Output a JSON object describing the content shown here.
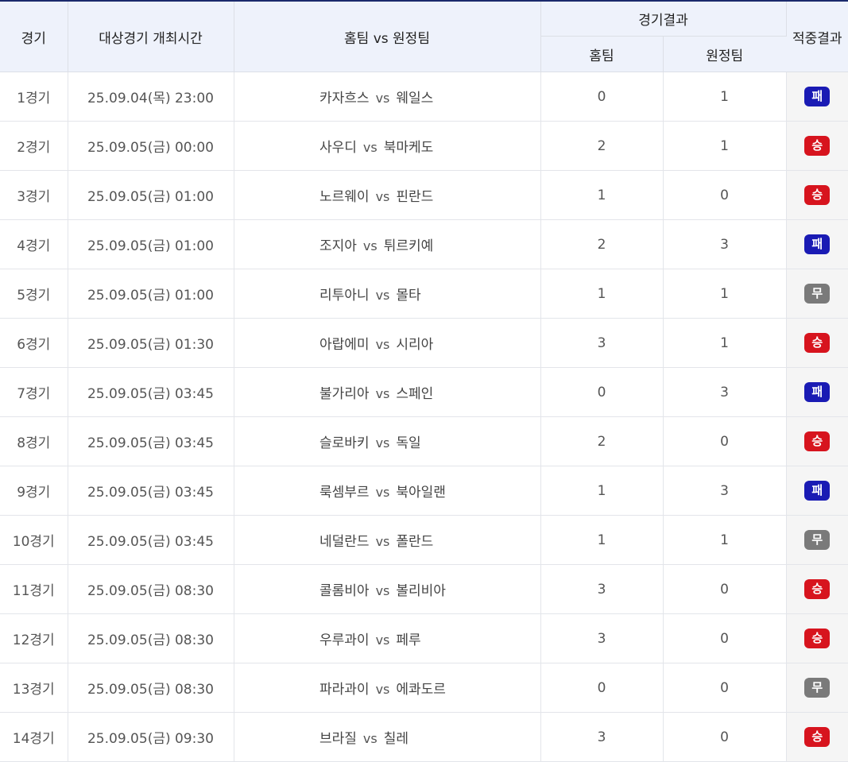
{
  "header": {
    "game": "경기",
    "time": "대상경기 개최시간",
    "match": "홈팀 vs 원정팀",
    "result_group": "경기결과",
    "home": "홈팀",
    "away": "원정팀",
    "hit": "적중결과"
  },
  "vs_label": "vs",
  "colors": {
    "win": "#d7141e",
    "lose": "#1a1bb4",
    "draw": "#7a7a7a",
    "header_bg": "#eef2fb"
  },
  "rows": [
    {
      "game": "1경기",
      "time": "25.09.04(목) 23:00",
      "home": "카자흐스",
      "away": "웨일스",
      "home_score": "0",
      "away_score": "1",
      "result": "패",
      "result_type": "lose"
    },
    {
      "game": "2경기",
      "time": "25.09.05(금) 00:00",
      "home": "사우디",
      "away": "북마케도",
      "home_score": "2",
      "away_score": "1",
      "result": "승",
      "result_type": "win"
    },
    {
      "game": "3경기",
      "time": "25.09.05(금) 01:00",
      "home": "노르웨이",
      "away": "핀란드",
      "home_score": "1",
      "away_score": "0",
      "result": "승",
      "result_type": "win"
    },
    {
      "game": "4경기",
      "time": "25.09.05(금) 01:00",
      "home": "조지아",
      "away": "튀르키예",
      "home_score": "2",
      "away_score": "3",
      "result": "패",
      "result_type": "lose"
    },
    {
      "game": "5경기",
      "time": "25.09.05(금) 01:00",
      "home": "리투아니",
      "away": "몰타",
      "home_score": "1",
      "away_score": "1",
      "result": "무",
      "result_type": "draw"
    },
    {
      "game": "6경기",
      "time": "25.09.05(금) 01:30",
      "home": "아랍에미",
      "away": "시리아",
      "home_score": "3",
      "away_score": "1",
      "result": "승",
      "result_type": "win"
    },
    {
      "game": "7경기",
      "time": "25.09.05(금) 03:45",
      "home": "불가리아",
      "away": "스페인",
      "home_score": "0",
      "away_score": "3",
      "result": "패",
      "result_type": "lose"
    },
    {
      "game": "8경기",
      "time": "25.09.05(금) 03:45",
      "home": "슬로바키",
      "away": "독일",
      "home_score": "2",
      "away_score": "0",
      "result": "승",
      "result_type": "win"
    },
    {
      "game": "9경기",
      "time": "25.09.05(금) 03:45",
      "home": "룩셈부르",
      "away": "북아일랜",
      "home_score": "1",
      "away_score": "3",
      "result": "패",
      "result_type": "lose"
    },
    {
      "game": "10경기",
      "time": "25.09.05(금) 03:45",
      "home": "네덜란드",
      "away": "폴란드",
      "home_score": "1",
      "away_score": "1",
      "result": "무",
      "result_type": "draw"
    },
    {
      "game": "11경기",
      "time": "25.09.05(금) 08:30",
      "home": "콜롬비아",
      "away": "볼리비아",
      "home_score": "3",
      "away_score": "0",
      "result": "승",
      "result_type": "win"
    },
    {
      "game": "12경기",
      "time": "25.09.05(금) 08:30",
      "home": "우루과이",
      "away": "페루",
      "home_score": "3",
      "away_score": "0",
      "result": "승",
      "result_type": "win"
    },
    {
      "game": "13경기",
      "time": "25.09.05(금) 08:30",
      "home": "파라과이",
      "away": "에콰도르",
      "home_score": "0",
      "away_score": "0",
      "result": "무",
      "result_type": "draw"
    },
    {
      "game": "14경기",
      "time": "25.09.05(금) 09:30",
      "home": "브라질",
      "away": "칠레",
      "home_score": "3",
      "away_score": "0",
      "result": "승",
      "result_type": "win"
    }
  ]
}
